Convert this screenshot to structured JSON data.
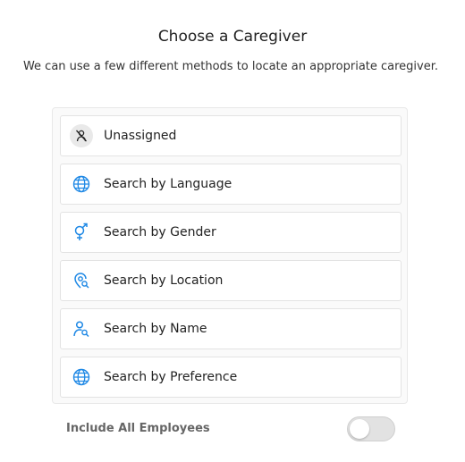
{
  "header": {
    "title": "Choose a Caregiver",
    "subtitle": "We can use a few different methods to locate an appropriate caregiver."
  },
  "options": [
    {
      "label": "Unassigned",
      "icon": "person-slash-icon"
    },
    {
      "label": "Search by Language",
      "icon": "globe-icon"
    },
    {
      "label": "Search by Gender",
      "icon": "gender-icon"
    },
    {
      "label": "Search by Location",
      "icon": "location-search-icon"
    },
    {
      "label": "Search by Name",
      "icon": "person-search-icon"
    },
    {
      "label": "Search by Preference",
      "icon": "globe-icon"
    }
  ],
  "footer": {
    "include_all_label": "Include All Employees",
    "include_all_enabled": false
  },
  "colors": {
    "accent": "#1E88E5",
    "text": "#222222",
    "muted_text": "#666666"
  }
}
